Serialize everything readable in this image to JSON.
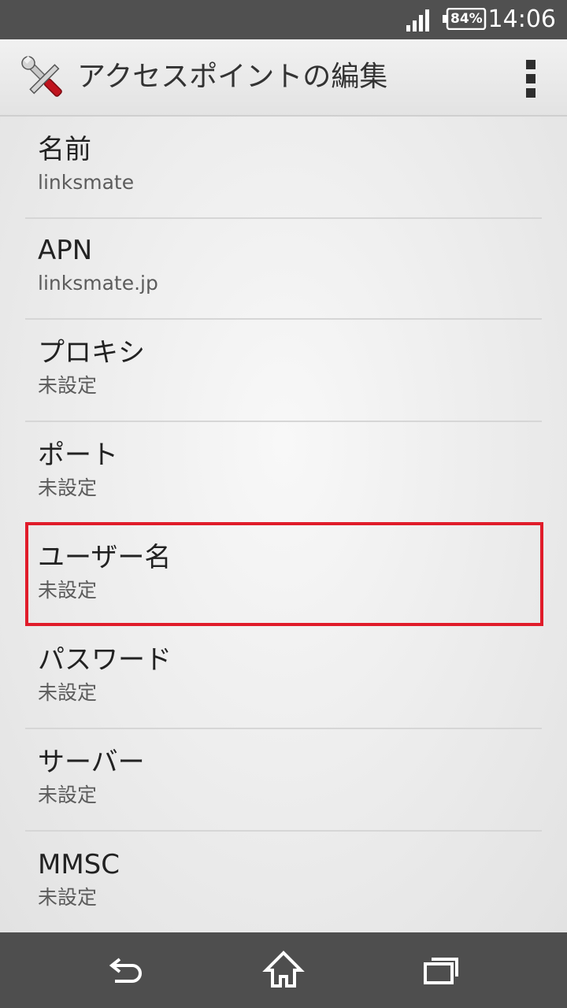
{
  "status_bar": {
    "battery_percent": "84%",
    "time": "14:06",
    "signal_icon": "signal-bars-icon",
    "battery_icon": "battery-icon"
  },
  "action_bar": {
    "title": "アクセスポイントの編集",
    "app_icon": "tools-icon",
    "overflow_icon": "overflow-menu-icon"
  },
  "settings": [
    {
      "title": "名前",
      "summary": "linksmate"
    },
    {
      "title": "APN",
      "summary": "linksmate.jp"
    },
    {
      "title": "プロキシ",
      "summary": "未設定"
    },
    {
      "title": "ポート",
      "summary": "未設定"
    },
    {
      "title": "ユーザー名",
      "summary": "未設定"
    },
    {
      "title": "パスワード",
      "summary": "未設定"
    },
    {
      "title": "サーバー",
      "summary": "未設定"
    },
    {
      "title": "MMSC",
      "summary": "未設定"
    }
  ],
  "highlight": {
    "item": "ユーザー名",
    "color": "#e01c2a"
  },
  "nav_bar": {
    "back_icon": "back-icon",
    "home_icon": "home-icon",
    "recents_icon": "recent-apps-icon"
  },
  "colors": {
    "status_bar": "#505050",
    "nav_bar": "#4e4e4e",
    "highlight": "#e01c2a"
  }
}
